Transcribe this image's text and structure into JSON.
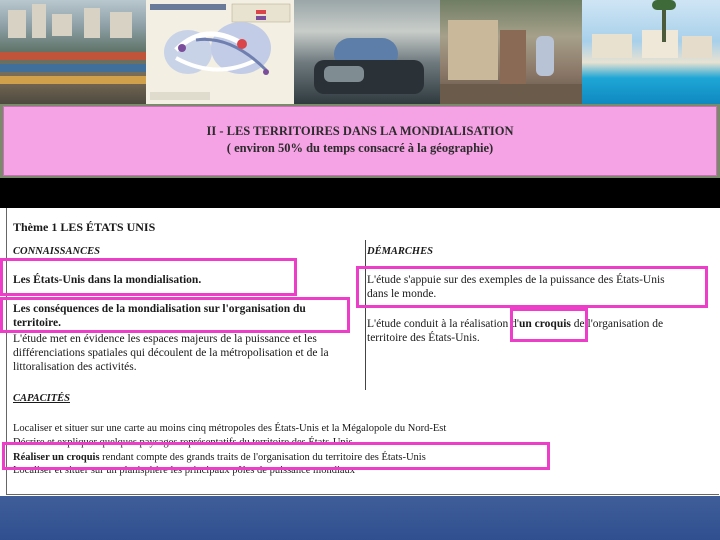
{
  "title": {
    "line1": "II - LES TERRITOIRES DANS LA MONDIALISATION",
    "line2": "( environ 50% du temps consacré à la géographie)"
  },
  "document": {
    "theme": "Thème 1   LES ÉTATS UNIS",
    "connaissances_heading": "CONNAISSANCES",
    "demarches_heading": "DÉMARCHES",
    "connaissances": [
      "Les États-Unis dans la mondialisation.",
      "Les conséquences de la mondialisation sur l'organisation du",
      "territoire.",
      "L'étude met en évidence les espaces majeurs de la puissance et les",
      "différenciations spatiales qui découlent de la métropolisation et de la",
      "littoralisation des activités."
    ],
    "demarches": [
      "L'étude s'appuie sur des exemples de la puissance des États-Unis",
      "dans le monde.",
      "L'étude conduit à la réalisation d'",
      "un croquis",
      " de l'organisation de",
      "territoire des États-Unis."
    ],
    "capacites_heading": "CAPACITÉS",
    "capacites": [
      "Localiser et situer sur une carte au moins cinq métropoles des États-Unis et la Mégalopole du Nord-Est",
      "Décrire et expliquer quelques paysages représentatifs du territoire des États-Unis",
      "Réaliser un croquis",
      " rendant compte des grands traits de l'organisation du territoire des États-Unis",
      "Localiser et situer sur un planisphère les principaux pôles de puissance mondiaux"
    ]
  },
  "colors": {
    "title_bg": "#f6a3e6",
    "highlight": "#ec3ec8",
    "footer": "#2f4f8f"
  }
}
